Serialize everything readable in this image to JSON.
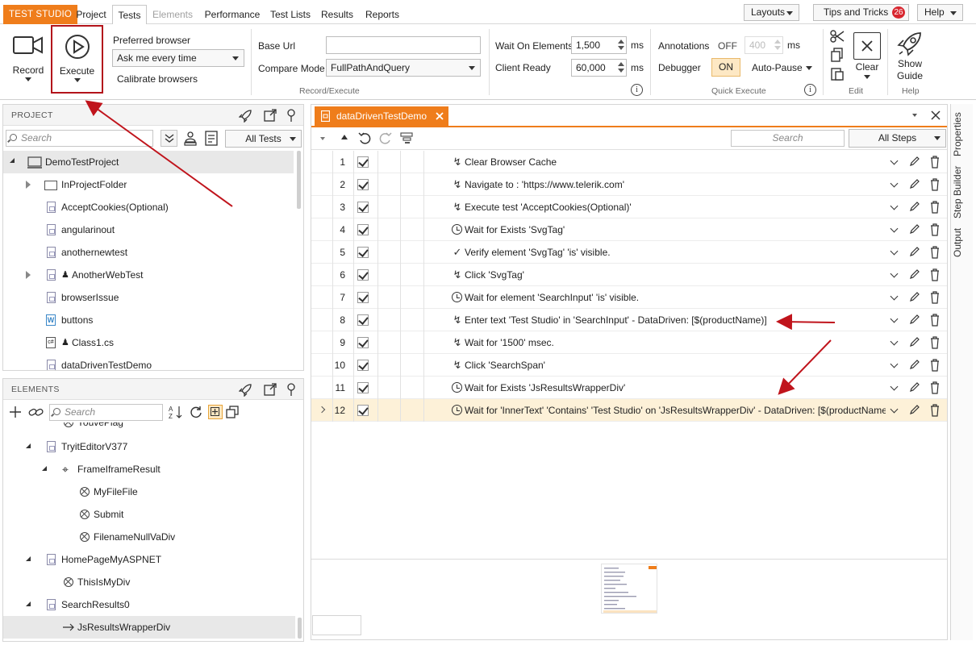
{
  "app": {
    "brand": "TEST STUDIO"
  },
  "top_tabs": [
    {
      "label": "Project"
    },
    {
      "label": "Tests"
    },
    {
      "label": "Elements"
    },
    {
      "label": "Performance"
    },
    {
      "label": "Test Lists"
    },
    {
      "label": "Results"
    },
    {
      "label": "Reports"
    }
  ],
  "top_right": {
    "layouts": "Layouts",
    "tips": "Tips and Tricks",
    "tips_badge": "26",
    "help": "Help"
  },
  "ribbon": {
    "record": "Record",
    "execute": "Execute",
    "preferred_browser_label": "Preferred browser",
    "preferred_browser_value": "Ask me every time",
    "calibrate": "Calibrate browsers",
    "base_url_label": "Base Url",
    "base_url_value": "",
    "compare_mode_label": "Compare Mode",
    "compare_mode_value": "FullPathAndQuery",
    "section_record_execute": "Record/Execute",
    "wait_on_elements_label": "Wait On Elements",
    "wait_on_elements_value": "1,500",
    "client_ready_label": "Client Ready",
    "client_ready_value": "60,000",
    "ms": "ms",
    "annotations_label": "Annotations",
    "annotations_state": "OFF",
    "annotations_value": "400",
    "debugger_label": "Debugger",
    "debugger_state": "ON",
    "auto_pause": "Auto-Pause",
    "section_quick_execute": "Quick Execute",
    "clear": "Clear",
    "section_edit": "Edit",
    "show_guide_1": "Show",
    "show_guide_2": "Guide",
    "section_help": "Help"
  },
  "project_panel": {
    "title": "PROJECT",
    "search_placeholder": "Search",
    "filter": "All Tests",
    "items": [
      {
        "label": "DemoTestProject"
      },
      {
        "label": "InProjectFolder"
      },
      {
        "label": "AcceptCookies(Optional)"
      },
      {
        "label": "angularinout"
      },
      {
        "label": "anothernewtest"
      },
      {
        "label": "AnotherWebTest"
      },
      {
        "label": "browserIssue"
      },
      {
        "label": "buttons"
      },
      {
        "label": "Class1.cs"
      },
      {
        "label": "dataDrivenTestDemo"
      }
    ]
  },
  "elements_panel": {
    "title": "ELEMENTS",
    "search_placeholder": "Search",
    "items": [
      {
        "label": "YouvePlag"
      },
      {
        "label": "TryitEditorV377"
      },
      {
        "label": "FrameIframeResult"
      },
      {
        "label": "MyFileFile"
      },
      {
        "label": "Submit"
      },
      {
        "label": "FilenameNullVaDiv"
      },
      {
        "label": "HomePageMyASPNET"
      },
      {
        "label": "ThisIsMyDiv"
      },
      {
        "label": "SearchResults0"
      },
      {
        "label": "JsResultsWrapperDiv"
      }
    ]
  },
  "editor": {
    "tab_title": "dataDrivenTestDemo",
    "search_placeholder": "Search",
    "filter": "All Steps",
    "steps": [
      {
        "num": "1",
        "icon": "bolt",
        "text": "Clear Browser Cache"
      },
      {
        "num": "2",
        "icon": "bolt",
        "text": "Navigate to : 'https://www.telerik.com'"
      },
      {
        "num": "3",
        "icon": "bolt",
        "text": "Execute test 'AcceptCookies(Optional)'"
      },
      {
        "num": "4",
        "icon": "clock",
        "text": "Wait for Exists 'SvgTag'"
      },
      {
        "num": "5",
        "icon": "check",
        "text": "Verify element 'SvgTag' 'is' visible."
      },
      {
        "num": "6",
        "icon": "bolt",
        "text": "Click 'SvgTag'"
      },
      {
        "num": "7",
        "icon": "clock",
        "text": "Wait for element 'SearchInput' 'is' visible."
      },
      {
        "num": "8",
        "icon": "bolt",
        "text": "Enter text 'Test Studio' in 'SearchInput' - DataDriven: [$(productName)]"
      },
      {
        "num": "9",
        "icon": "bolt",
        "text": "Wait for '1500' msec."
      },
      {
        "num": "10",
        "icon": "bolt",
        "text": "Click 'SearchSpan'"
      },
      {
        "num": "11",
        "icon": "clock",
        "text": "Wait for Exists 'JsResultsWrapperDiv'"
      },
      {
        "num": "12",
        "icon": "clock",
        "text": "Wait for 'InnerText' 'Contains' 'Test Studio' on 'JsResultsWrapperDiv' - DataDriven: [$(productName)]"
      }
    ]
  },
  "side_tabs": [
    {
      "label": "Properties"
    },
    {
      "label": "Step Builder"
    },
    {
      "label": "Output"
    }
  ],
  "colors": {
    "brand": "#ef7d1b",
    "selected_row": "#fdf1d8",
    "annotation_arrow": "#c0141c"
  }
}
